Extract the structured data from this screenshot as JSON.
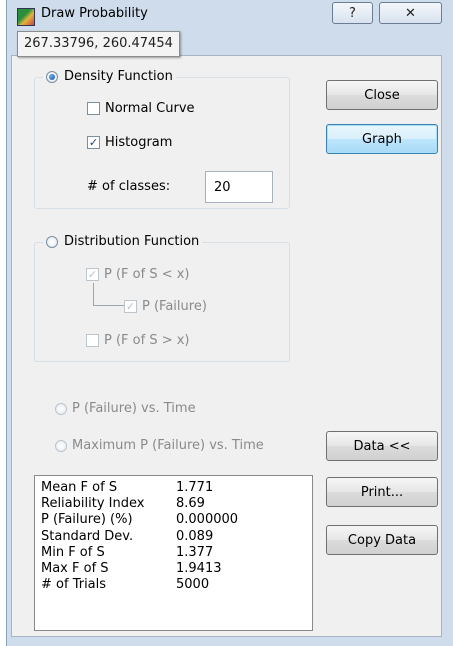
{
  "window": {
    "title": "Draw Probability",
    "help_label": "?",
    "close_label": "✕"
  },
  "tooltip": {
    "coords": "267.33796, 260.47454"
  },
  "density": {
    "label": "Density Function",
    "normal_curve": {
      "label": "Normal Curve",
      "checked": false
    },
    "histogram": {
      "label": "Histogram",
      "checked": true
    },
    "classes_label": "# of classes:",
    "classes_value": "20"
  },
  "distribution": {
    "label": "Distribution Function",
    "p_less": "P (F of S < x)",
    "p_failure": "P (Failure)",
    "p_greater": "P (F of S > x)"
  },
  "options": {
    "p_failure_time": "P (Failure) vs. Time",
    "max_p_failure_time": "Maximum P (Failure) vs. Time"
  },
  "buttons": {
    "close": "Close",
    "graph": "Graph",
    "data": "Data <<",
    "print": "Print...",
    "copy_data": "Copy Data"
  },
  "stats": [
    {
      "label": "Mean F of S",
      "value": "1.771"
    },
    {
      "label": "Reliability Index",
      "value": "8.69"
    },
    {
      "label": "P (Failure) (%)",
      "value": "0.000000"
    },
    {
      "label": "Standard Dev.",
      "value": "0.089"
    },
    {
      "label": "Min F of S",
      "value": "1.377"
    },
    {
      "label": "Max F of S",
      "value": "1.9413"
    },
    {
      "label": "# of Trials",
      "value": "5000"
    }
  ],
  "colors": {
    "frame": "#cfdceb",
    "client": "#f0f0f0",
    "focus_button": "#bee6fd",
    "disabled_text": "#8a8a8a"
  }
}
